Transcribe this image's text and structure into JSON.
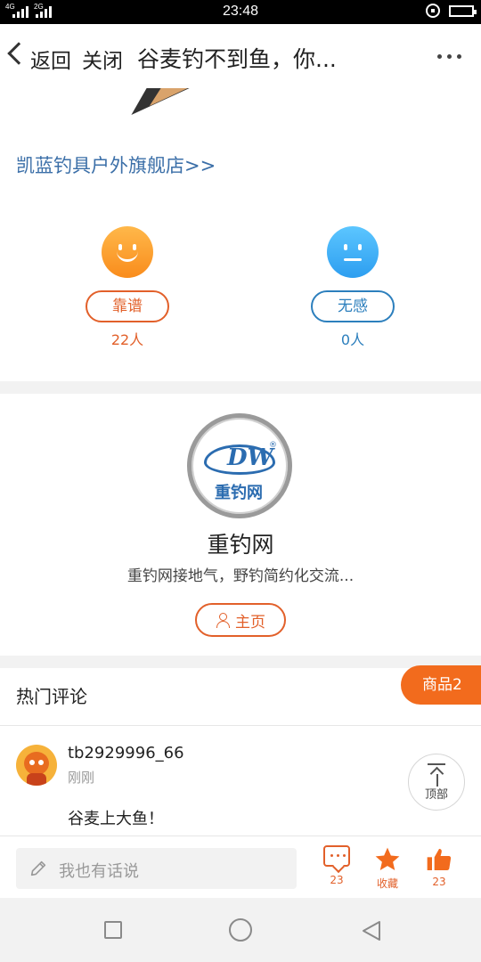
{
  "status_bar": {
    "time": "23:48",
    "network_left": "4G",
    "network_right": "2G"
  },
  "header": {
    "back_label": "返回",
    "close_label": "关闭",
    "title": "谷麦钓不到鱼，你..."
  },
  "store_link": "凯蓝钓具户外旗舰店>>",
  "reactions": {
    "good": {
      "label": "靠谱",
      "count": "22人"
    },
    "meh": {
      "label": "无感",
      "count": "0人"
    }
  },
  "profile": {
    "logo_text": "DW",
    "logo_cn": "重钓网",
    "logo_reg": "®",
    "name": "重钓网",
    "description": "重钓网接地气，野钓简约化交流...",
    "home_label": "主页"
  },
  "comments": {
    "section_title": "热门评论",
    "products_tab": "商品2",
    "items": [
      {
        "user": "tb2929996_66",
        "time": "刚刚",
        "text": "谷麦上大鱼！"
      }
    ],
    "back_to_top_label": "顶部"
  },
  "bottom_bar": {
    "input_placeholder": "我也有话说",
    "comment_count": "23",
    "favorite_label": "收藏",
    "like_count": "23"
  },
  "colors": {
    "accent": "#e2602a",
    "link_blue": "#3b6fa8",
    "products_tab": "#f26b1d"
  }
}
